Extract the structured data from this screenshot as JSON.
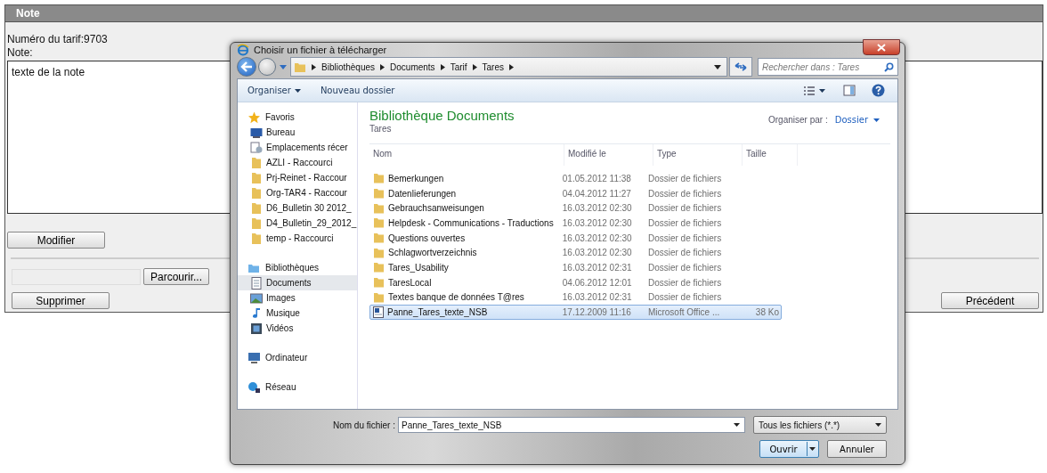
{
  "page": {
    "title": "Note",
    "tariff_label": "Numéro du tarif:9703",
    "note_label": "Note:",
    "note_text": "texte de la note",
    "modify_button": "Modifier",
    "browse_button": "Parcourir...",
    "delete_button": "Supprimer",
    "previous_button": "Précédent"
  },
  "dialog": {
    "title": "Choisir un fichier à télécharger",
    "breadcrumb": [
      "Bibliothèques",
      "Documents",
      "Tarif",
      "Tares"
    ],
    "search": {
      "placeholder": "Rechercher dans : Tares"
    },
    "toolbar": {
      "organize": "Organiser",
      "new_folder": "Nouveau dossier"
    },
    "sidebar": [
      {
        "label": "Favoris",
        "kind": "star",
        "selected": false,
        "children": [
          {
            "label": "Bureau",
            "kind": "desktop",
            "selected": false
          },
          {
            "label": "Emplacements récer",
            "kind": "recent",
            "selected": false
          },
          {
            "label": "AZLI - Raccourci",
            "kind": "folder",
            "selected": false
          },
          {
            "label": "Prj-Reinet - Raccour",
            "kind": "folder",
            "selected": false
          },
          {
            "label": "Org-TAR4 - Raccour",
            "kind": "folder",
            "selected": false
          },
          {
            "label": "D6_Bulletin 30 2012_",
            "kind": "folder",
            "selected": false
          },
          {
            "label": "D4_Bulletin_29_2012_",
            "kind": "folder",
            "selected": false
          },
          {
            "label": "temp - Raccourci",
            "kind": "folder",
            "selected": false
          }
        ]
      },
      {
        "label": "Bibliothèques",
        "kind": "library",
        "selected": false,
        "children": [
          {
            "label": "Documents",
            "kind": "document",
            "selected": true
          },
          {
            "label": "Images",
            "kind": "images",
            "selected": false
          },
          {
            "label": "Musique",
            "kind": "music",
            "selected": false
          },
          {
            "label": "Vidéos",
            "kind": "video",
            "selected": false
          }
        ]
      },
      {
        "label": "Ordinateur",
        "kind": "computer",
        "selected": false
      },
      {
        "label": "Réseau",
        "kind": "network",
        "selected": false
      }
    ],
    "library_title": "Bibliothèque Documents",
    "library_subtitle": "Tares",
    "arrange_label": "Organiser par :",
    "arrange_value": "Dossier",
    "columns": [
      "Nom",
      "Modifié le",
      "Type",
      "Taille"
    ],
    "files": [
      {
        "name": "Bemerkungen",
        "modified": "01.05.2012 11:38",
        "type": "Dossier de fichiers",
        "kind": "folder",
        "selected": false
      },
      {
        "name": "Datenlieferungen",
        "modified": "04.04.2012 11:27",
        "type": "Dossier de fichiers",
        "kind": "folder",
        "selected": false
      },
      {
        "name": "Gebrauchsanweisungen",
        "modified": "16.03.2012 02:30",
        "type": "Dossier de fichiers",
        "kind": "folder",
        "selected": false
      },
      {
        "name": "Helpdesk - Communications - Traductions",
        "modified": "16.03.2012 02:30",
        "type": "Dossier de fichiers",
        "kind": "folder",
        "selected": false
      },
      {
        "name": "Questions ouvertes",
        "modified": "16.03.2012 02:30",
        "type": "Dossier de fichiers",
        "kind": "folder",
        "selected": false
      },
      {
        "name": "Schlagwortverzeichnis",
        "modified": "16.03.2012 02:30",
        "type": "Dossier de fichiers",
        "kind": "folder",
        "selected": false
      },
      {
        "name": "Tares_Usability",
        "modified": "16.03.2012 02:31",
        "type": "Dossier de fichiers",
        "kind": "folder",
        "selected": false
      },
      {
        "name": "TaresLocal",
        "modified": "04.06.2012 12:01",
        "type": "Dossier de fichiers",
        "kind": "folder",
        "selected": false
      },
      {
        "name": "Textes banque de données T@res",
        "modified": "16.03.2012 02:31",
        "type": "Dossier de fichiers",
        "kind": "folder",
        "selected": false
      },
      {
        "name": "Panne_Tares_texte_NSB",
        "modified": "17.12.2009 11:16",
        "type": "Microsoft Office ...",
        "size": "38 Ko",
        "kind": "document",
        "selected": true
      }
    ],
    "filename_label": "Nom du fichier :",
    "filename": "Panne_Tares_texte_NSB",
    "filetype": "Tous les fichiers (*.*)",
    "open_button": "Ouvrir",
    "cancel_button": "Annuler"
  }
}
